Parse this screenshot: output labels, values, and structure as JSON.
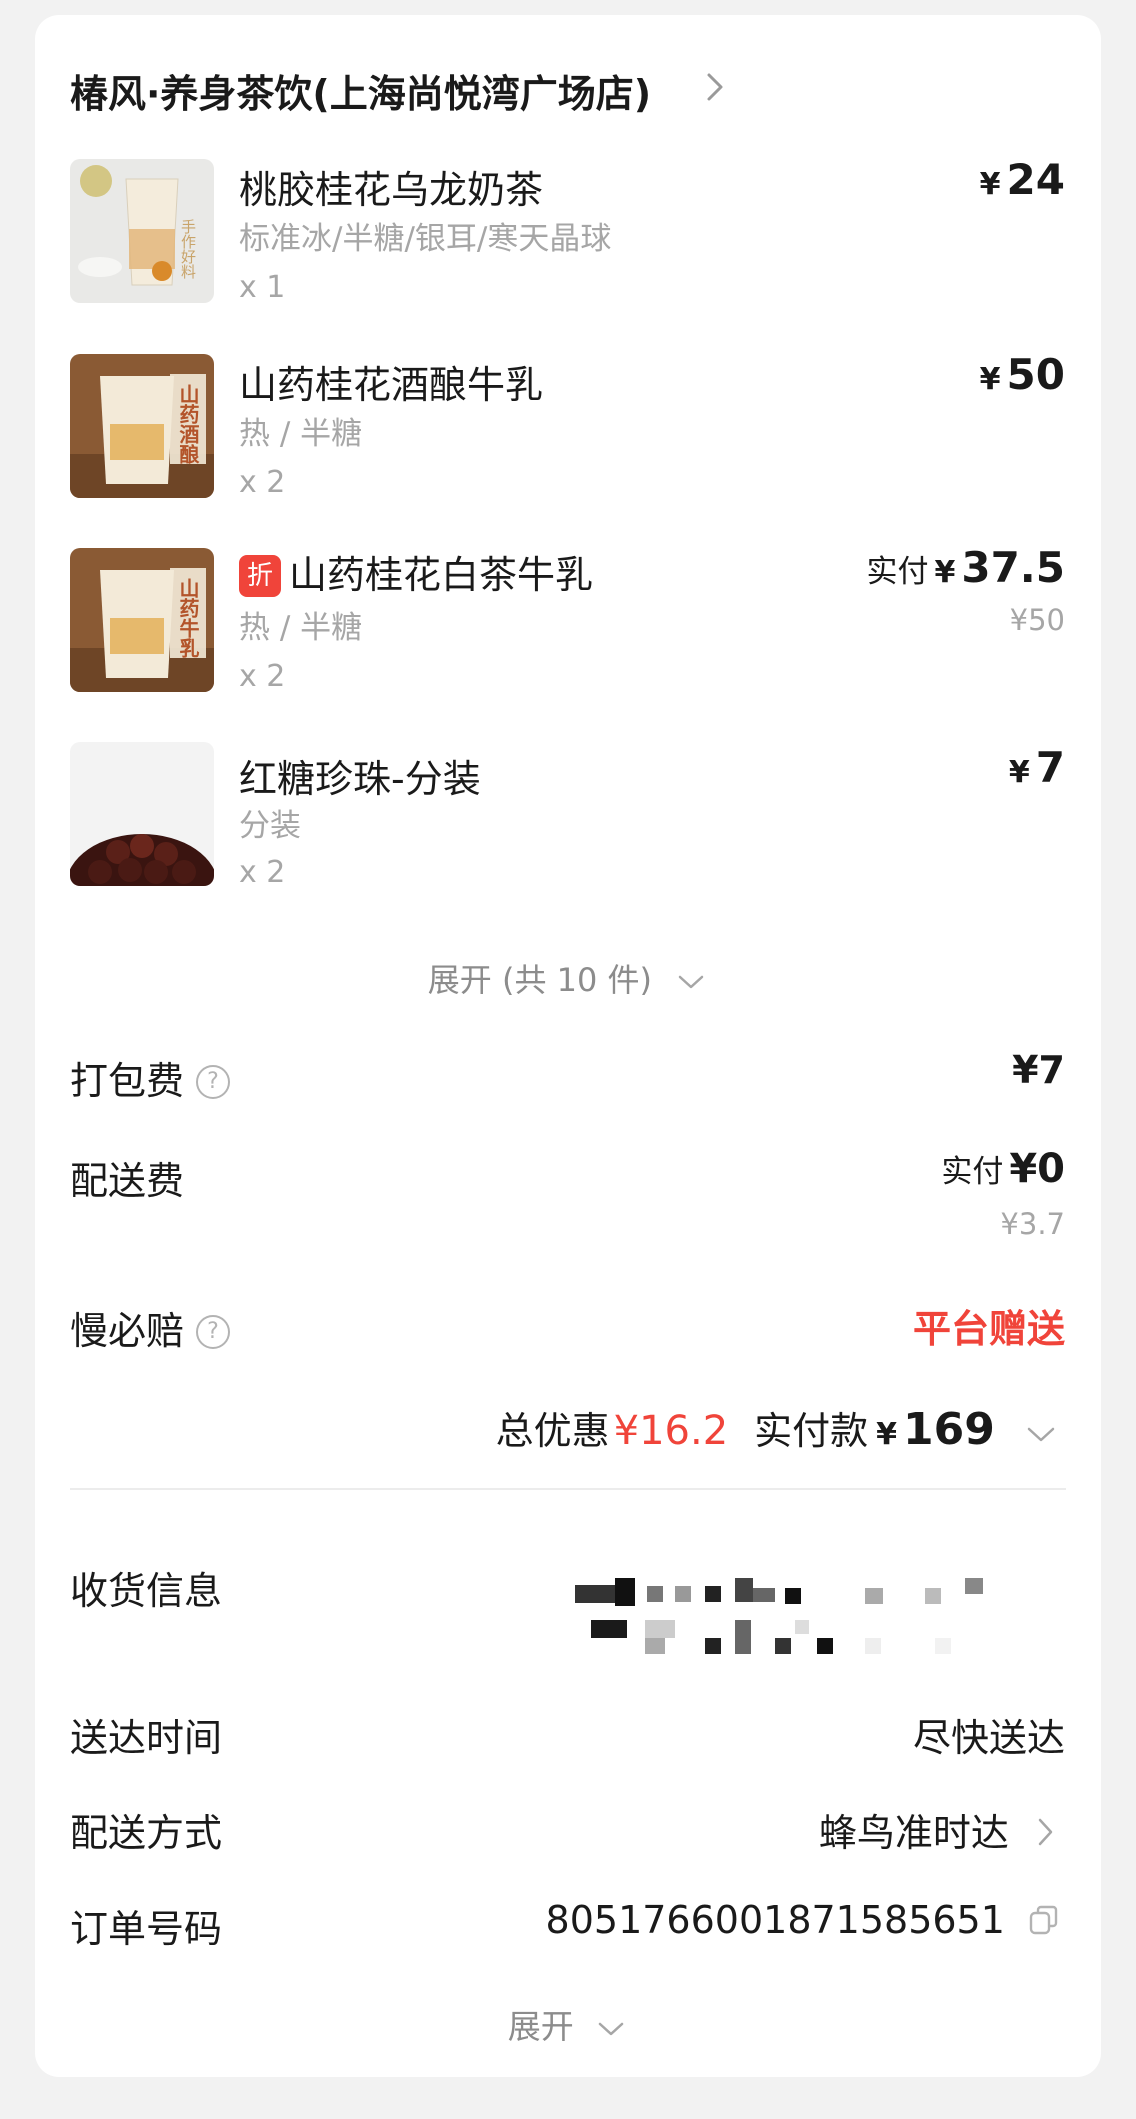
{
  "store": {
    "name": "椿风·养身茶饮(上海尚悦湾广场店)"
  },
  "items": [
    {
      "name": "桃胶桂花乌龙奶茶",
      "spec": "标准冰/半糖/银耳/寒天晶球",
      "qty": "x 1",
      "currency": "¥",
      "price": "24"
    },
    {
      "name": "山药桂花酒酿牛乳",
      "spec": "热 / 半糖",
      "qty": "x 2",
      "currency": "¥",
      "price": "50"
    },
    {
      "badge": "折",
      "name": "山药桂花白茶牛乳",
      "spec": "热 / 半糖",
      "qty": "x 2",
      "price_prefix": "实付",
      "currency": "¥",
      "price": "37.5",
      "original_price": "¥50"
    },
    {
      "name": "红糖珍珠-分装",
      "spec": "分装",
      "qty": "x 2",
      "currency": "¥",
      "price": "7"
    }
  ],
  "thumb_texts": {
    "item1": "手作好料",
    "item2": "山药酒酿",
    "item3": "山药牛乳"
  },
  "expand_items": {
    "label": "展开 (共 10 件)",
    "icon": "chevron-down-icon"
  },
  "fees": {
    "packaging": {
      "label": "打包费",
      "value": "¥7",
      "help_icon": "?"
    },
    "delivery": {
      "label": "配送费",
      "prefix": "实付",
      "value": "¥0",
      "original": "¥3.7"
    },
    "late_comp": {
      "label": "慢必赔",
      "value": "平台赠送",
      "help_icon": "?"
    }
  },
  "summary": {
    "discount_label": "总优惠",
    "discount_value": "¥16.2",
    "paid_label": "实付款",
    "paid_currency": "¥",
    "paid_value": "169"
  },
  "info": {
    "receiver": {
      "label": "收货信息"
    },
    "time": {
      "label": "送达时间",
      "value": "尽快送达"
    },
    "method": {
      "label": "配送方式",
      "value": "蜂鸟准时达"
    },
    "order": {
      "label": "订单号码",
      "value": "8051766001871585651"
    }
  },
  "expand_more": {
    "label": "展开"
  },
  "colors": {
    "accent_red": "#f0443a",
    "text": "#1a1a1a",
    "muted": "#a6a6a6"
  }
}
